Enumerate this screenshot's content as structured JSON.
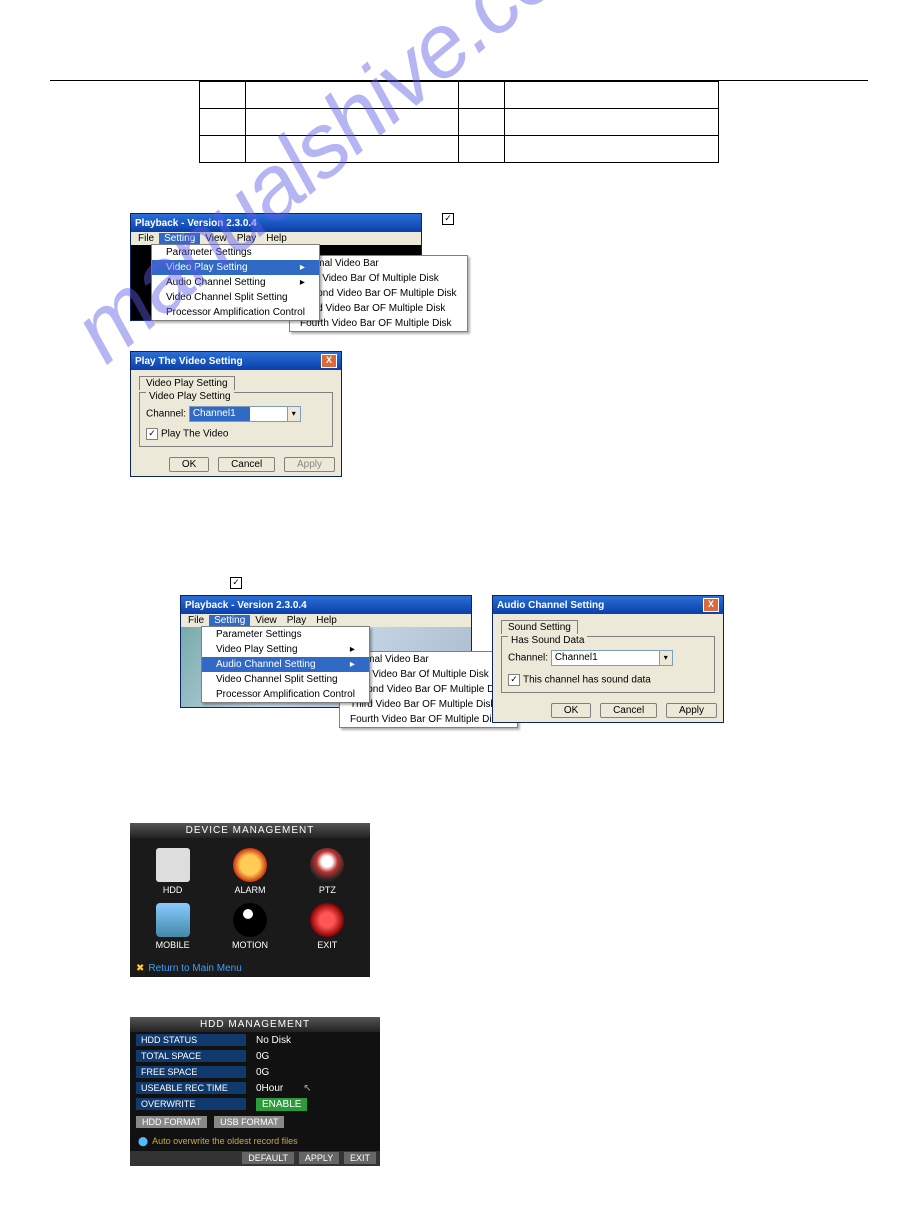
{
  "table": {
    "cells": [
      [
        "",
        "",
        "",
        ""
      ],
      [
        "",
        "",
        "",
        ""
      ],
      [
        "",
        "",
        "",
        ""
      ]
    ]
  },
  "menu1_title": "Playback - Version 2.3.0.4",
  "menubar": {
    "file": "File",
    "setting": "Setting",
    "view": "View",
    "play": "Play",
    "help": "Help"
  },
  "dropdown1": {
    "items": [
      "Parameter Settings",
      "Video Play Setting",
      "Audio Channel Setting",
      "Video Channel Split Setting",
      "Processor Amplification Control"
    ],
    "selected_index": 1
  },
  "submenu1": {
    "items": [
      "Normal Video Bar",
      "First Video Bar Of Multiple Disk",
      "Second Video Bar OF Multiple Disk",
      "Third Video Bar OF Multiple Disk",
      "Fourth Video Bar OF Multiple Disk"
    ]
  },
  "dlg_video": {
    "title": "Play The Video Setting",
    "tab": "Video Play Setting",
    "group": "Video Play Setting",
    "channel_label": "Channel:",
    "channel_value": "Channel1",
    "check_label": "Play The Video",
    "ok": "OK",
    "cancel": "Cancel",
    "apply": "Apply"
  },
  "menu2_title": "Playback - Version 2.3.0.4",
  "dropdown2": {
    "items": [
      "Parameter Settings",
      "Video Play Setting",
      "Audio Channel Setting",
      "Video Channel Split Setting",
      "Processor Amplification Control"
    ],
    "selected_index": 2
  },
  "submenu2": {
    "items": [
      "Normal Video Bar",
      "First Video Bar Of Multiple Disk",
      "Second Video Bar OF Multiple Disk",
      "Third Video Bar OF Multiple Disk",
      "Fourth Video Bar OF Multiple Disk"
    ]
  },
  "dlg_audio": {
    "title": "Audio Channel Setting",
    "tab": "Sound Setting",
    "group": "Has Sound Data",
    "channel_label": "Channel:",
    "channel_value": "Channel1",
    "check_label": "This channel has sound data",
    "ok": "OK",
    "cancel": "Cancel",
    "apply": "Apply"
  },
  "device": {
    "title": "DEVICE MANAGEMENT",
    "items": [
      {
        "label": "HDD"
      },
      {
        "label": "ALARM"
      },
      {
        "label": "PTZ"
      },
      {
        "label": "MOBILE"
      },
      {
        "label": "MOTION"
      },
      {
        "label": "EXIT"
      }
    ],
    "footer": "Return to Main Menu"
  },
  "hdd": {
    "title": "HDD MANAGEMENT",
    "rows": [
      {
        "label": "HDD STATUS",
        "value": "No Disk"
      },
      {
        "label": "TOTAL SPACE",
        "value": "0G"
      },
      {
        "label": "FREE SPACE",
        "value": "0G"
      },
      {
        "label": "USEABLE REC TIME",
        "value": "0Hour"
      },
      {
        "label": "OVERWRITE",
        "value": "ENABLE"
      }
    ],
    "btn1": "HDD FORMAT",
    "btn2": "USB FORMAT",
    "note": "Auto overwrite the oldest record files",
    "bottom": [
      "DEFAULT",
      "APPLY",
      "EXIT"
    ]
  }
}
